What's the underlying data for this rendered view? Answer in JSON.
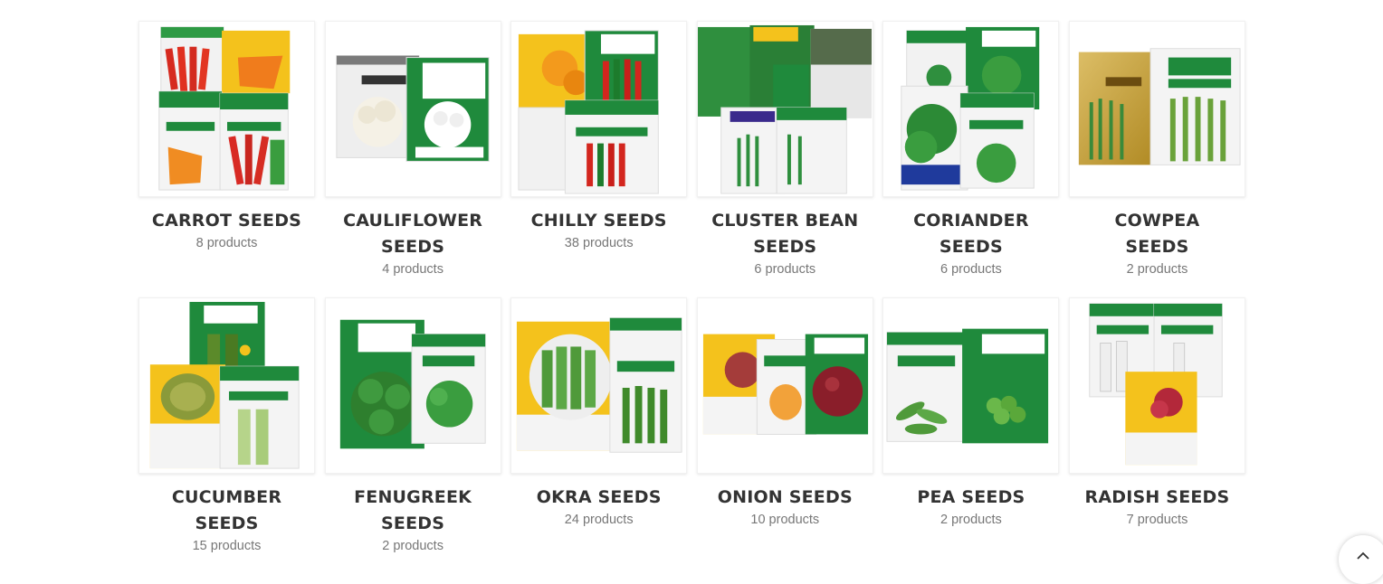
{
  "categories": [
    {
      "name": "CARROT SEEDS",
      "count": "8 products"
    },
    {
      "name": "CAULIFLOWER SEEDS",
      "count": "4 products"
    },
    {
      "name": "CHILLY SEEDS",
      "count": "38 products"
    },
    {
      "name": "CLUSTER BEAN SEEDS",
      "count": "6 products"
    },
    {
      "name": "CORIANDER SEEDS",
      "count": "6 products"
    },
    {
      "name": "COWPEA SEEDS",
      "count": "2 products"
    },
    {
      "name": "CUCUMBER SEEDS",
      "count": "15 products"
    },
    {
      "name": "FENUGREEK SEEDS",
      "count": "2 products"
    },
    {
      "name": "OKRA SEEDS",
      "count": "24 products"
    },
    {
      "name": "ONION SEEDS",
      "count": "10 products"
    },
    {
      "name": "PEA SEEDS",
      "count": "2 products"
    },
    {
      "name": "RADISH SEEDS",
      "count": "7 products"
    }
  ],
  "scroll_top": {
    "icon": "chevron-up-icon"
  },
  "colors": {
    "title": "#333333",
    "count": "#777777",
    "packet_green": "#1f8a3c",
    "packet_yellow": "#f4c21c"
  }
}
